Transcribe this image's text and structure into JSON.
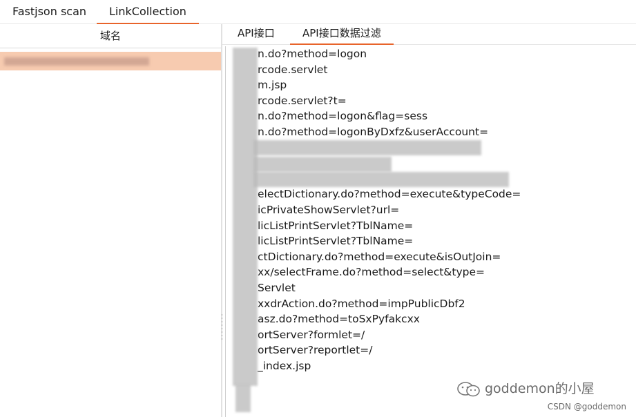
{
  "top_tabs": [
    {
      "label": "Fastjson scan"
    },
    {
      "label": "LinkCollection"
    }
  ],
  "left_panel": {
    "header": "域名"
  },
  "right_panel": {
    "tabs": [
      {
        "label": "API接口"
      },
      {
        "label": "API接口数据过滤"
      }
    ],
    "lines": [
      "n.do?method=logon",
      "rcode.servlet",
      "m.jsp",
      "rcode.servlet?t=",
      "n.do?method=logon&flag=sess",
      "n.do?method=logonByDxfz&userAccount=",
      "",
      "",
      "",
      "electDictionary.do?method=execute&typeCode=",
      "icPrivateShowServlet?url=",
      "licListPrintServlet?TblName=",
      "licListPrintServlet?TblName=",
      "ctDictionary.do?method=execute&isOutJoin=",
      "xx/selectFrame.do?method=select&type=",
      "Servlet",
      "xxdrAction.do?method=impPublicDbf2",
      "asz.do?method=toSxPyfakcxx",
      "ortServer?formlet=/",
      "ortServer?reportlet=/",
      "_index.jsp"
    ]
  },
  "watermark": {
    "text": "goddemon的小屋",
    "icon": "wechat-icon",
    "source": "CSDN @goddemon"
  },
  "colors": {
    "accent": "#e8642b",
    "selected_row": "#f7cbb0"
  }
}
